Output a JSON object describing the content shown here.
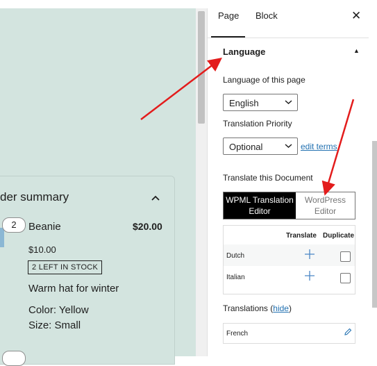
{
  "sidebar": {
    "tabs": [
      {
        "label": "Page"
      },
      {
        "label": "Block"
      }
    ],
    "close_glyph": "✕",
    "language_section": {
      "title": "Language",
      "caret": "▲",
      "language_label": "Language of this page",
      "language_value": "English",
      "priority_label": "Translation Priority",
      "priority_value": "Optional",
      "edit_terms": "edit terms",
      "translate_doc_label": "Translate this Document",
      "editor_options": [
        "WPML Translation Editor",
        "WordPress Editor"
      ],
      "table_headers": {
        "translate": "Translate",
        "duplicate": "Duplicate"
      },
      "languages": [
        {
          "name": "Dutch"
        },
        {
          "name": "Italian"
        }
      ],
      "translations_label": "Translations",
      "hide_link": "hide",
      "translations": [
        {
          "name": "French"
        }
      ]
    }
  },
  "order": {
    "title": "der summary",
    "product": {
      "qty": "2",
      "name": "Beanie",
      "price": "$20.00",
      "unit_price": "$10.00",
      "stock_badge": "2 LEFT IN STOCK",
      "description": "Warm hat for winter",
      "color": "Color: Yellow",
      "size": "Size: Small"
    }
  },
  "colors": {
    "canvas_bg": "#d3e4df",
    "link": "#2271b1",
    "annotation_arrow": "#e31c1c",
    "selected_segment": "#000000"
  },
  "icons": {
    "dropdown": "chevron-down-icon",
    "add": "plus-icon",
    "edit": "pencil-icon",
    "close": "close-icon",
    "collapse": "chevron-up-icon"
  }
}
